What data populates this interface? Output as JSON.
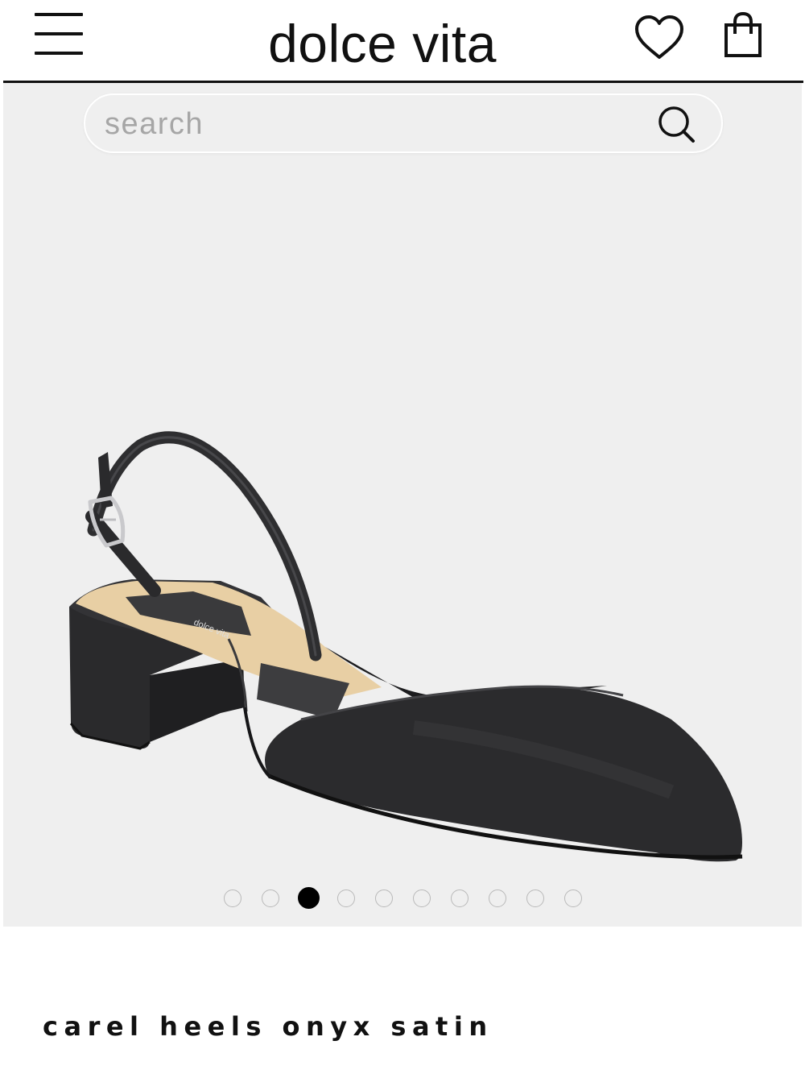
{
  "header": {
    "brand": "dolce vita",
    "menu_icon": "hamburger-menu-icon",
    "wishlist_icon": "heart-icon",
    "bag_icon": "shopping-bag-icon"
  },
  "search": {
    "placeholder": "search",
    "icon": "search-icon"
  },
  "gallery": {
    "image_count": 10,
    "active_index": 2,
    "dots": [
      {
        "active": false
      },
      {
        "active": false
      },
      {
        "active": true
      },
      {
        "active": false
      },
      {
        "active": false
      },
      {
        "active": false
      },
      {
        "active": false
      },
      {
        "active": false
      },
      {
        "active": false
      },
      {
        "active": false
      }
    ],
    "insole_logo": "dolce vita"
  },
  "product": {
    "title": "carel heels onyx satin"
  },
  "colors": {
    "background": "#ffffff",
    "gallery_background": "#efefef",
    "text": "#111111",
    "shoe": "#2b2b2d",
    "insole": "#e8cfa4"
  }
}
